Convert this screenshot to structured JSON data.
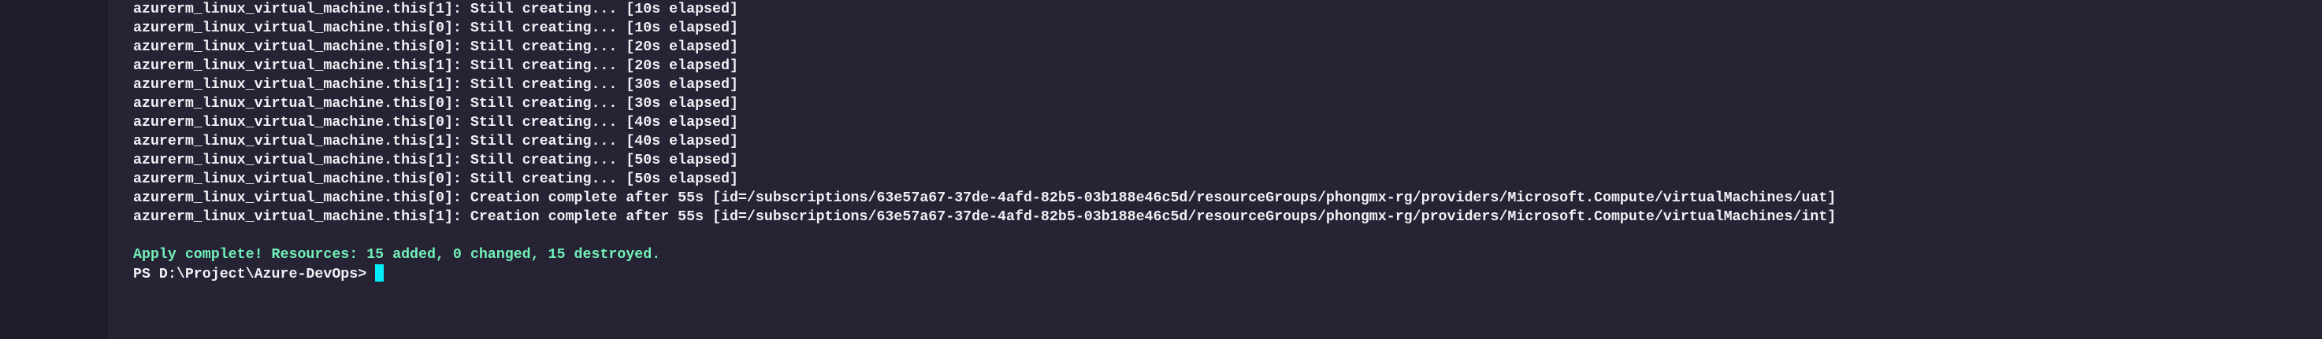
{
  "terminal": {
    "lines": [
      "azurerm_linux_virtual_machine.this[1]: Still creating... [10s elapsed]",
      "azurerm_linux_virtual_machine.this[0]: Still creating... [10s elapsed]",
      "azurerm_linux_virtual_machine.this[0]: Still creating... [20s elapsed]",
      "azurerm_linux_virtual_machine.this[1]: Still creating... [20s elapsed]",
      "azurerm_linux_virtual_machine.this[1]: Still creating... [30s elapsed]",
      "azurerm_linux_virtual_machine.this[0]: Still creating... [30s elapsed]",
      "azurerm_linux_virtual_machine.this[0]: Still creating... [40s elapsed]",
      "azurerm_linux_virtual_machine.this[1]: Still creating... [40s elapsed]",
      "azurerm_linux_virtual_machine.this[1]: Still creating... [50s elapsed]",
      "azurerm_linux_virtual_machine.this[0]: Still creating... [50s elapsed]",
      "azurerm_linux_virtual_machine.this[0]: Creation complete after 55s [id=/subscriptions/63e57a67-37de-4afd-82b5-03b188e46c5d/resourceGroups/phongmx-rg/providers/Microsoft.Compute/virtualMachines/uat]",
      "azurerm_linux_virtual_machine.this[1]: Creation complete after 55s [id=/subscriptions/63e57a67-37de-4afd-82b5-03b188e46c5d/resourceGroups/phongmx-rg/providers/Microsoft.Compute/virtualMachines/int]"
    ],
    "summary": "Apply complete! Resources: 15 added, 0 changed, 15 destroyed.",
    "prompt": "PS D:\\Project\\Azure-DevOps> "
  },
  "colors": {
    "background": "#262335",
    "sidebar": "#1f1c2c",
    "success": "#72f1b8",
    "cursor": "#03edf9"
  }
}
